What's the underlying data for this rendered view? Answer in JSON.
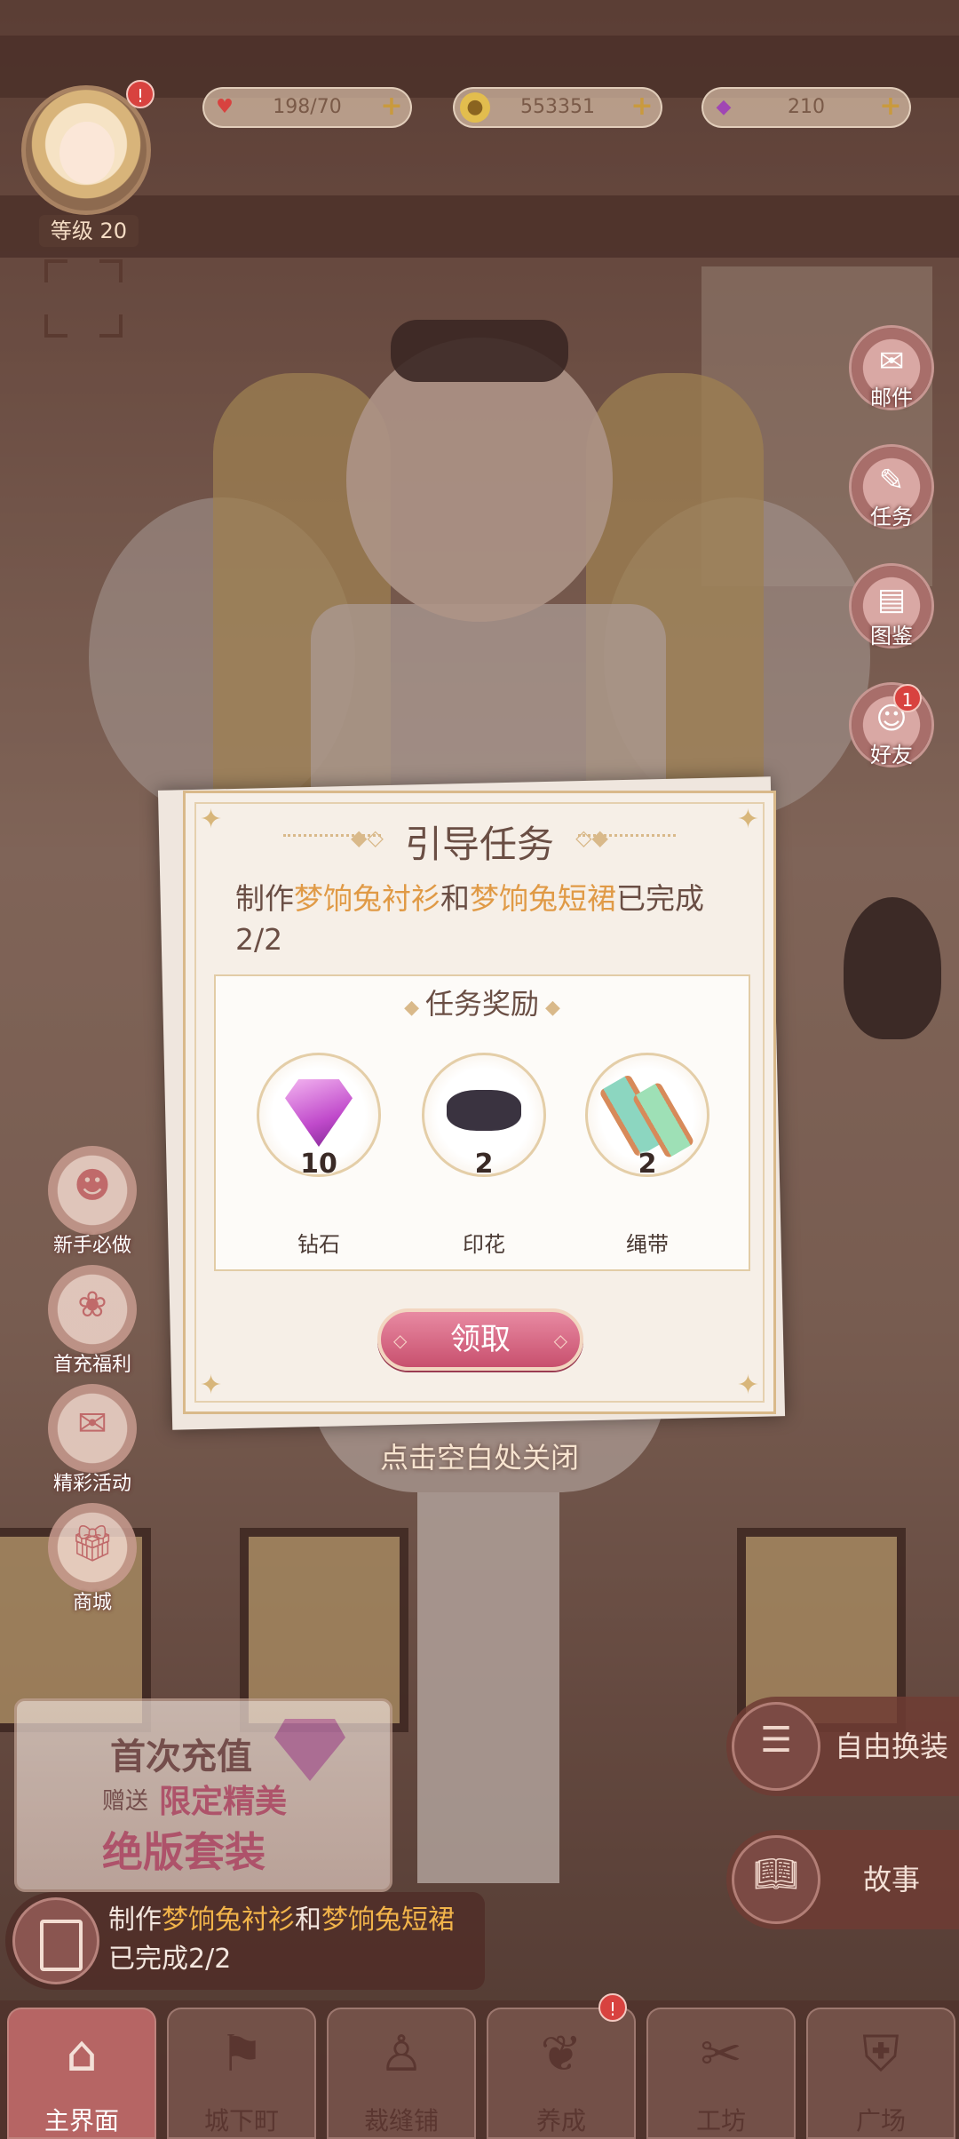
{
  "top_bar": {
    "avatar_badge": "!",
    "level_label": "等级 20",
    "resources": [
      {
        "icon": "heart-icon",
        "value": "198/70",
        "color": "#d8423f"
      },
      {
        "icon": "coin-icon",
        "value": "553351",
        "color": "#d4a83a"
      },
      {
        "icon": "diamond-icon",
        "value": "210",
        "color": "#a046b4"
      }
    ]
  },
  "side_menu": [
    {
      "label": "邮件",
      "icon": "mail-icon"
    },
    {
      "label": "任务",
      "icon": "task-icon"
    },
    {
      "label": "图鉴",
      "icon": "catalog-icon"
    },
    {
      "label": "好友",
      "icon": "friends-icon",
      "badge": "1"
    }
  ],
  "left_menu": [
    {
      "label": "新手必做",
      "icon": "newbie-icon"
    },
    {
      "label": "首充福利",
      "icon": "first-charge-icon"
    },
    {
      "label": "精彩活动",
      "icon": "event-icon"
    },
    {
      "label": "商城",
      "icon": "shop-icon"
    }
  ],
  "promo": {
    "line1": "首次充值",
    "line2": "赠送",
    "line3": "限定精美",
    "line4": "绝版套装"
  },
  "task_strip": {
    "prefix": "制作",
    "item1": "梦饷兔衬衫",
    "mid": "和",
    "item2": "梦饷兔短裙",
    "status": "已完成2/2"
  },
  "right_buttons": [
    {
      "label": "自由换装",
      "icon": "wardrobe-icon"
    },
    {
      "label": "故事",
      "icon": "story-book-icon"
    }
  ],
  "bottom_nav": [
    {
      "label": "主界面",
      "icon": "home-icon",
      "active": true
    },
    {
      "label": "城下町",
      "icon": "town-flag-icon"
    },
    {
      "label": "裁缝铺",
      "icon": "dress-icon"
    },
    {
      "label": "养成",
      "icon": "growth-icon",
      "badge": "!"
    },
    {
      "label": "工坊",
      "icon": "workshop-icon"
    },
    {
      "label": "广场",
      "icon": "plaza-icon"
    }
  ],
  "modal": {
    "title": "引导任务",
    "desc_prefix": "制作",
    "desc_item1": "梦饷兔衬衫",
    "desc_mid": "和",
    "desc_item2": "梦饷兔短裙",
    "desc_suffix": "已完成2/2",
    "rewards_title": "任务奖励",
    "rewards": [
      {
        "name": "钻石",
        "count": "10",
        "icon": "diamond-icon"
      },
      {
        "name": "印花",
        "count": "2",
        "icon": "print-icon"
      },
      {
        "name": "绳带",
        "count": "2",
        "icon": "ribbon-spool-icon"
      }
    ],
    "claim_label": "领取"
  },
  "close_hint": "点击空白处关闭"
}
